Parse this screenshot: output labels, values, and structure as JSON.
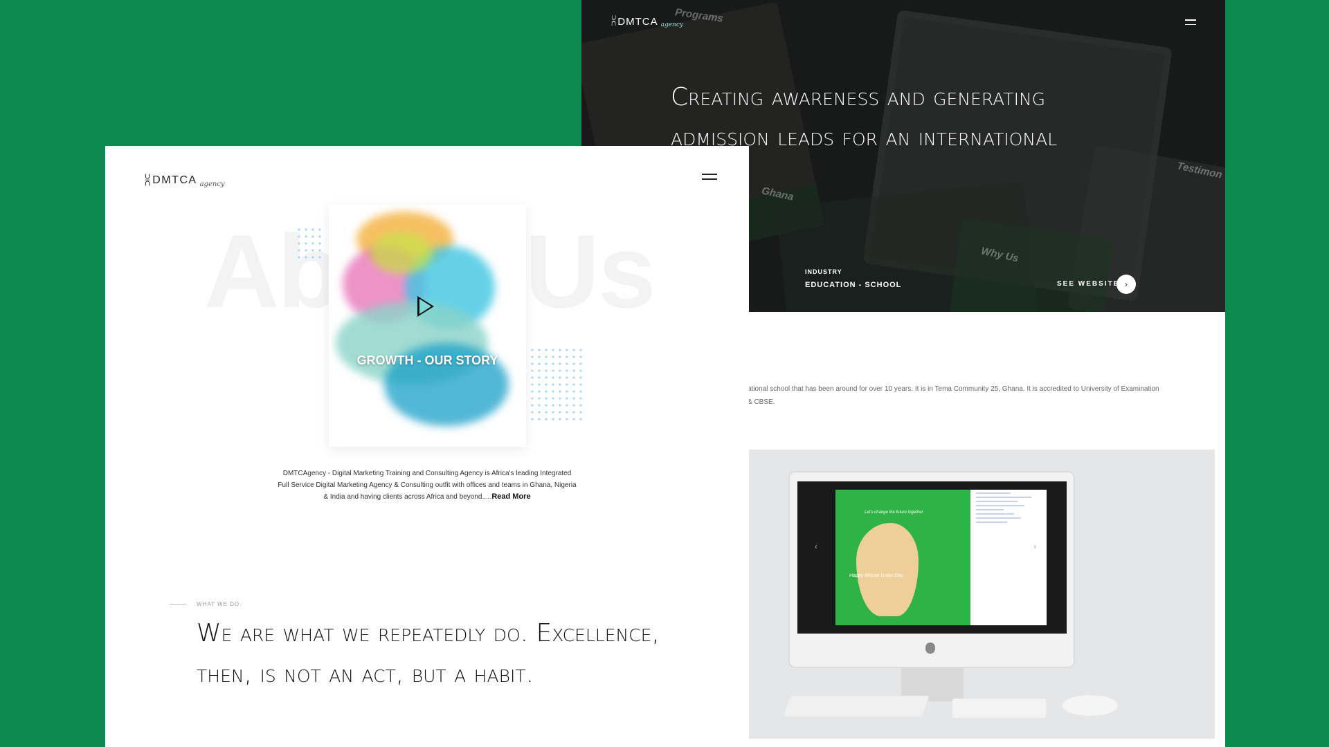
{
  "hero": {
    "logo_mark": "⩈",
    "logo_name": "DMTCA",
    "logo_script": "agency",
    "title": "Creating awareness and generating admission leads for an international",
    "industry_label": "INDUSTRY",
    "industry_value": "EDUCATION - SCHOOL",
    "see_website": "SEE WEBSITE",
    "see_icon": "›",
    "bg_tags": [
      "Programs",
      "Ghana",
      "Why Us",
      "Testimon"
    ]
  },
  "case": {
    "description": "ational school that has been around for over 10 years. It is in Tema Community 25, Ghana. It is accredited to University of Examination & CBSE.",
    "post_caption": "Let's change the future together",
    "post_day": "Happy African Union Day",
    "prev_icon": "‹",
    "next_icon": "›"
  },
  "front": {
    "logo_mark": "⩈",
    "logo_name": "DMTCA",
    "logo_script": "agency",
    "bg_word": "About Us",
    "card_title": "GROWTH - OUR STORY",
    "about_text": "DMTCAgency - Digital Marketing Training and Consulting Agency is Africa's leading Integrated Full Service Digital Marketing Agency & Consulting outfit with offices and teams in Ghana, Nigeria & India and having clients across Africa and beyond.....",
    "read_more": "Read More",
    "what_we_do": "WHAT WE DO.",
    "quote": "We are what we repeatedly do. Excellence, then, is not an act, but a habit."
  },
  "colors": {
    "background": "#0b8a4f",
    "hero_bg": "#1c1f1d",
    "product_bg": "#e5e6e7"
  }
}
